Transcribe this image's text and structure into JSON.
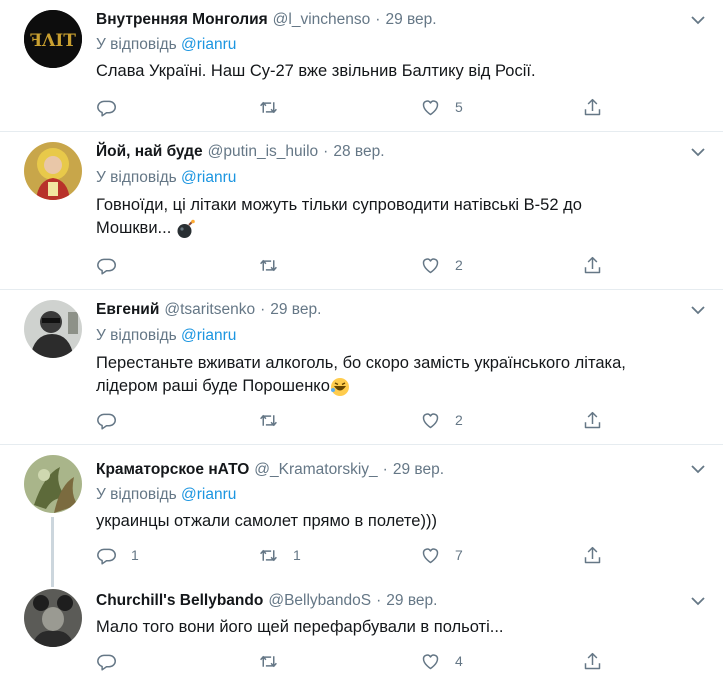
{
  "colors": {
    "link": "#1b95e0",
    "muted": "#657786",
    "text": "#14171a",
    "border": "#e6ecf0"
  },
  "tweets": [
    {
      "name": "Внутренняя Монголия",
      "handle": "@l_vinchenso",
      "dot": "·",
      "date": "29 вер.",
      "reply_prefix": "У відповідь",
      "reply_to": "@rianru",
      "text": "Слава Україні. Наш Су-27 вже звільнив Балтику від Росії.",
      "replies": "",
      "retweets": "",
      "likes": "5"
    },
    {
      "name": "Йой, най буде",
      "handle": "@putin_is_huilo",
      "dot": "·",
      "date": "28 вер.",
      "reply_prefix": "У відповідь",
      "reply_to": "@rianru",
      "text_line1": "Говноїди, ці літаки можуть тільки супроводити натівські В-52 до",
      "text_line2": "Мошкви...",
      "emoji": "bomb-emoji",
      "replies": "",
      "retweets": "",
      "likes": "2"
    },
    {
      "name": "Евгений",
      "handle": "@tsaritsenko",
      "dot": "·",
      "date": "29 вер.",
      "reply_prefix": "У відповідь",
      "reply_to": "@rianru",
      "text_line1": "Перестаньте вживати алкоголь, бо скоро замість українського літака,",
      "text_line2": "лідером раші буде Порошенко",
      "emoji": "rofl-emoji",
      "replies": "",
      "retweets": "",
      "likes": "2"
    },
    {
      "name": "Краматорское нАТО",
      "handle": "@_Kramatorskiy_",
      "dot": "·",
      "date": "29 вер.",
      "reply_prefix": "У відповідь",
      "reply_to": "@rianru",
      "text": "украинцы отжали самолет прямо в полете)))",
      "replies": "1",
      "retweets": "1",
      "likes": "7"
    },
    {
      "name": "Churchill's Bellybando",
      "handle": "@BellybandoS",
      "dot": "·",
      "date": "29 вер.",
      "text": "Мало того вони його щей перефарбували в польоті...",
      "replies": "",
      "retweets": "",
      "likes": "4"
    }
  ]
}
